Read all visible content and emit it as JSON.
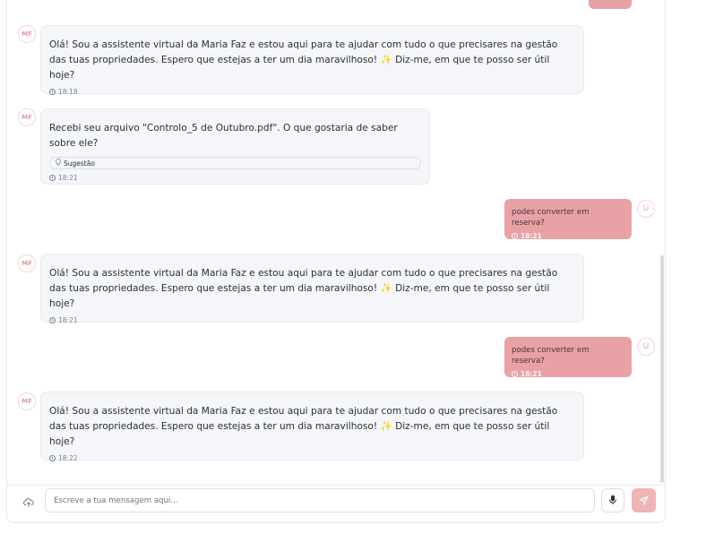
{
  "colors": {
    "user_bubble": "#e8a2a6",
    "assistant_bubble": "#f4f6f9",
    "accent": "#f0b3b6"
  },
  "messages": [
    {
      "role": "assistant",
      "avatar": "MF",
      "text": "Olá! Sou a assistente virtual da Maria Faz e estou aqui para te ajudar com tudo o que precisares na gestão das tuas propriedades. Espero que estejas a ter um dia maravilhoso! ✨ Diz-me, em que te posso ser útil hoje?",
      "time": "18:18"
    },
    {
      "role": "assistant",
      "avatar": "MF",
      "text": "Recebi seu arquivo \"Controlo_5 de Outubro.pdf\". O que gostaria de saber sobre ele?",
      "suggestion": "Sugestão",
      "suggestion_icon": "lightbulb-icon",
      "time": "18:21"
    },
    {
      "role": "user",
      "avatar": "U",
      "text": "podes converter em reserva?",
      "time": "18:21"
    },
    {
      "role": "assistant",
      "avatar": "MF",
      "text": "Olá! Sou a assistente virtual da Maria Faz e estou aqui para te ajudar com tudo o que precisares na gestão das tuas propriedades. Espero que estejas a ter um dia maravilhoso! ✨ Diz-me, em que te posso ser útil hoje?",
      "time": "18:21"
    },
    {
      "role": "user",
      "avatar": "U",
      "text": "podes converter em reserva?",
      "time": "18:21"
    },
    {
      "role": "assistant",
      "avatar": "MF",
      "text": "Olá! Sou a assistente virtual da Maria Faz e estou aqui para te ajudar com tudo o que precisares na gestão das tuas propriedades. Espero que estejas a ter um dia maravilhoso! ✨ Diz-me, em que te posso ser útil hoje?",
      "time": "18:22"
    }
  ],
  "composer": {
    "placeholder": "Escreve a tua mensagem aqui...",
    "value": "",
    "upload_icon": "upload-cloud-icon",
    "mic_icon": "microphone-icon",
    "send_icon": "send-icon"
  }
}
